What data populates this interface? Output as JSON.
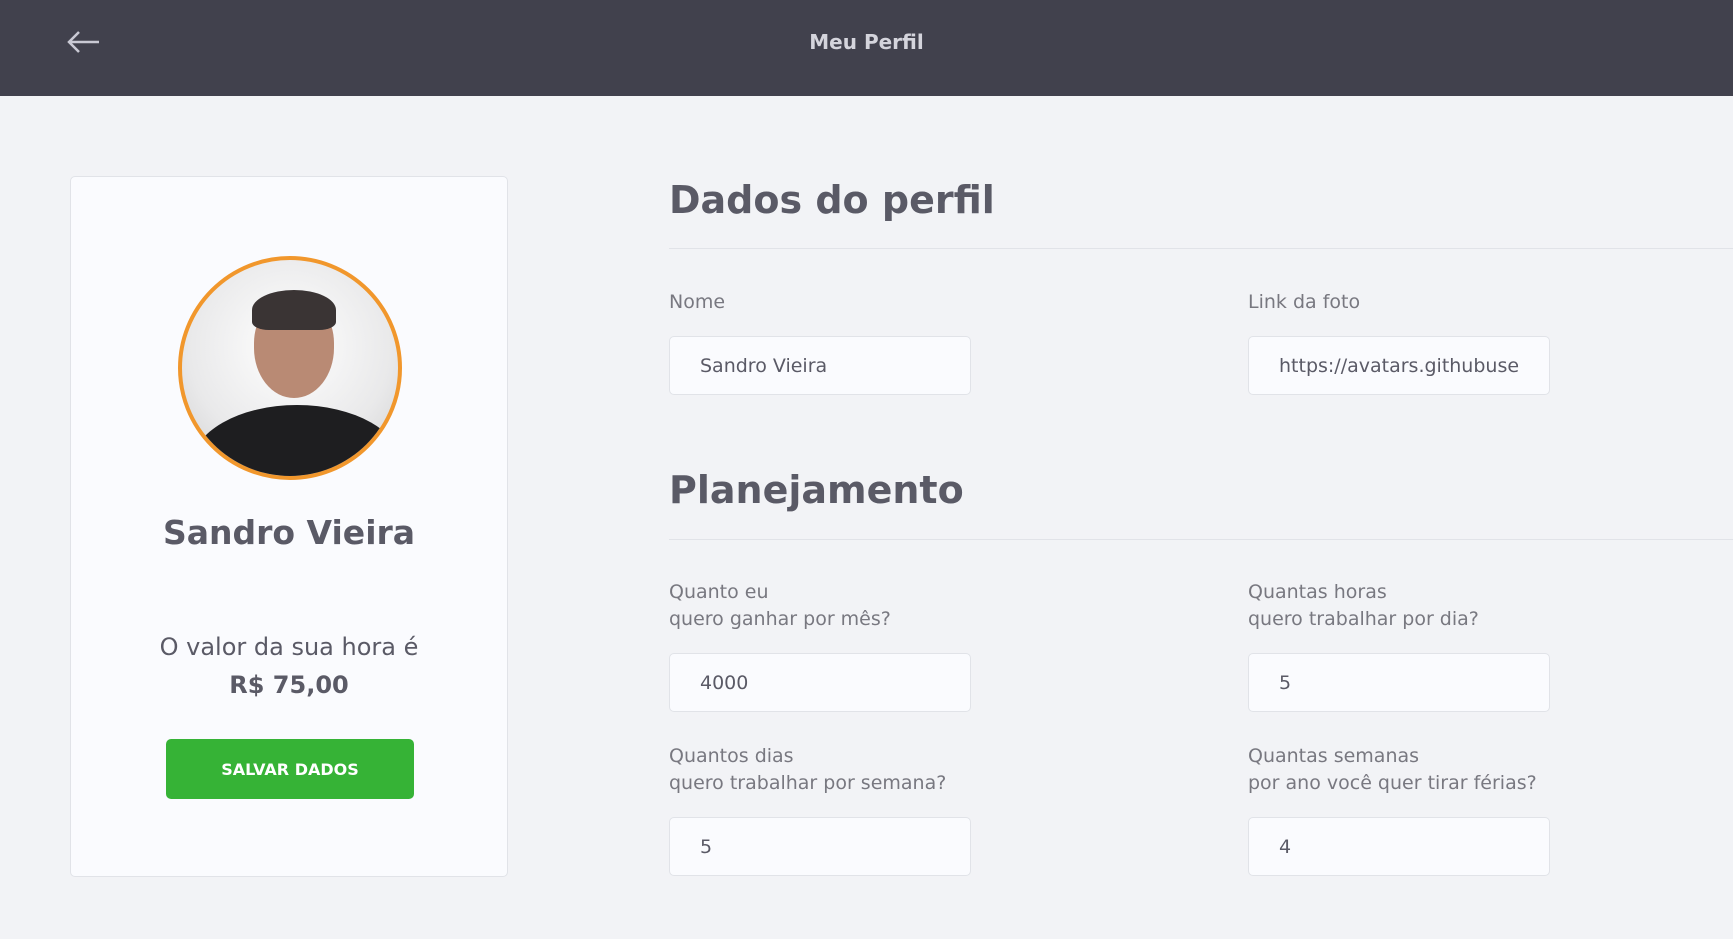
{
  "header": {
    "title": "Meu Perfil",
    "back_icon": "arrow-left-icon"
  },
  "profile_card": {
    "name": "Sandro Vieira",
    "hour_value_label": "O valor da sua hora é",
    "hour_value": "R$ 75,00",
    "save_label": "SALVAR DADOS",
    "accent": "#f1972c",
    "button_color": "#36b336"
  },
  "profile_section": {
    "title": "Dados do perfil",
    "name_label": "Nome",
    "name_value": "Sandro Vieira",
    "photo_label": "Link da foto",
    "photo_value": "https://avatars.githubuser"
  },
  "planning": {
    "title": "Planejamento",
    "monthly_label_1": "Quanto eu",
    "monthly_label_2": "quero ganhar por mês?",
    "monthly_value": "4000",
    "hours_label_1": "Quantas horas",
    "hours_label_2": "quero trabalhar por dia?",
    "hours_value": "5",
    "days_label_1": "Quantos dias",
    "days_label_2": "quero trabalhar por semana?",
    "days_value": "5",
    "vacation_label_1": "Quantas semanas",
    "vacation_label_2": "por ano você quer tirar férias?",
    "vacation_value": "4"
  }
}
